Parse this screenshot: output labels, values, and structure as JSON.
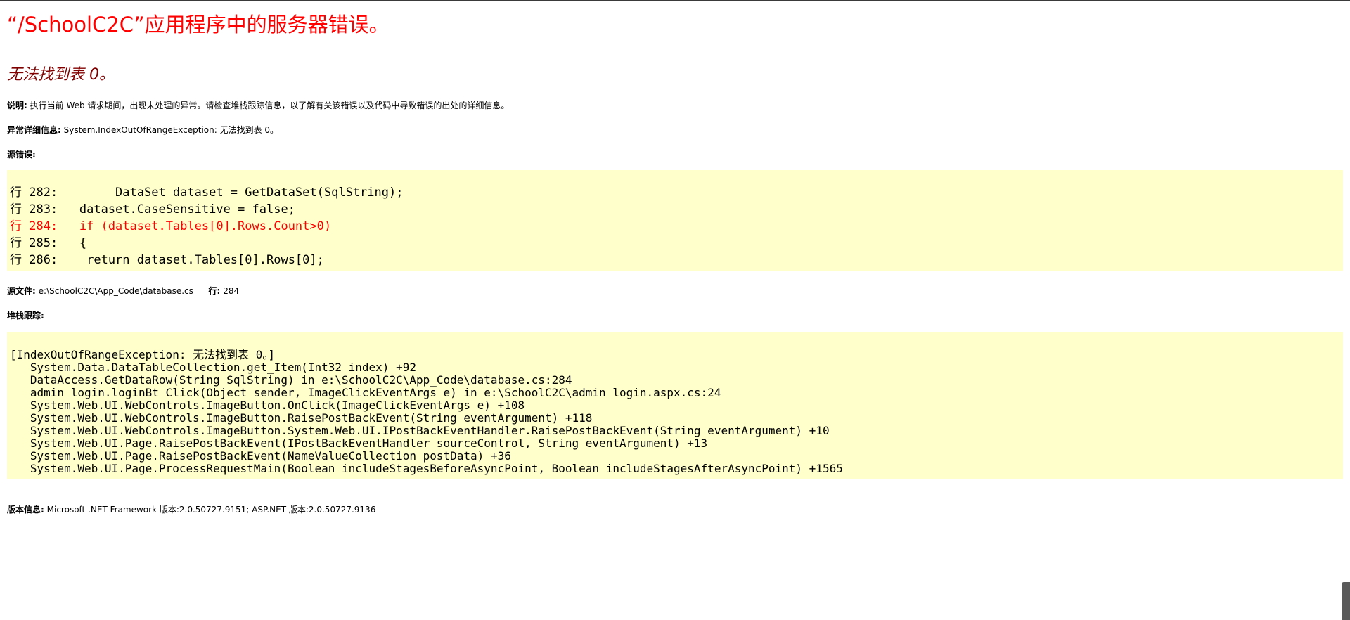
{
  "error_title": "“/SchoolC2C”应用程序中的服务器错误。",
  "error_message": "无法找到表 0。",
  "description": {
    "label": "说明:",
    "text": "执行当前 Web 请求期间，出现未处理的异常。请检查堆栈跟踪信息，以了解有关该错误以及代码中导致错误的出处的详细信息。"
  },
  "exception_details": {
    "label": "异常详细信息:",
    "text": "System.IndexOutOfRangeException: 无法找到表 0。"
  },
  "source_error": {
    "label": "源错误:",
    "lines": [
      "行 282:        DataSet dataset = GetDataSet(SqlString);",
      "行 283:   dataset.CaseSensitive = false;",
      "行 284:   if (dataset.Tables[0].Rows.Count>0)",
      "行 285:   {",
      "行 286:    return dataset.Tables[0].Rows[0];"
    ],
    "highlighted_line_index": 2
  },
  "source_file": {
    "label": "源文件:",
    "path": "e:\\SchoolC2C\\App_Code\\database.cs",
    "line_label": "行:",
    "line_number": "284"
  },
  "stack_trace": {
    "label": "堆栈跟踪:",
    "lines": [
      "[IndexOutOfRangeException: 无法找到表 0。]",
      "   System.Data.DataTableCollection.get_Item(Int32 index) +92",
      "   DataAccess.GetDataRow(String SqlString) in e:\\SchoolC2C\\App_Code\\database.cs:284",
      "   admin_login.loginBt_Click(Object sender, ImageClickEventArgs e) in e:\\SchoolC2C\\admin_login.aspx.cs:24",
      "   System.Web.UI.WebControls.ImageButton.OnClick(ImageClickEventArgs e) +108",
      "   System.Web.UI.WebControls.ImageButton.RaisePostBackEvent(String eventArgument) +118",
      "   System.Web.UI.WebControls.ImageButton.System.Web.UI.IPostBackEventHandler.RaisePostBackEvent(String eventArgument) +10",
      "   System.Web.UI.Page.RaisePostBackEvent(IPostBackEventHandler sourceControl, String eventArgument) +13",
      "   System.Web.UI.Page.RaisePostBackEvent(NameValueCollection postData) +36",
      "   System.Web.UI.Page.ProcessRequestMain(Boolean includeStagesBeforeAsyncPoint, Boolean includeStagesAfterAsyncPoint) +1565"
    ]
  },
  "version_info": {
    "label": "版本信息:",
    "text": "Microsoft .NET Framework 版本:2.0.50727.9151; ASP.NET 版本:2.0.50727.9136"
  },
  "colors": {
    "title": "#ff0000",
    "message": "#800000",
    "code_background": "#ffffcc",
    "highlight": "#ff0000",
    "rule": "#c0c0c0"
  }
}
